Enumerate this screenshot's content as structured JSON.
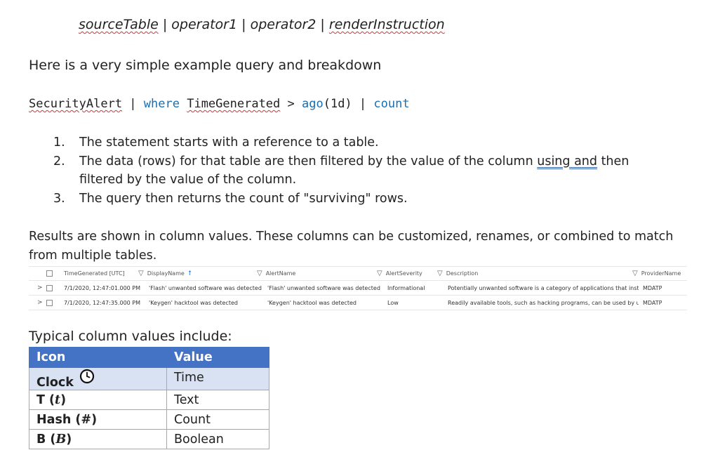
{
  "syntax": {
    "source": "sourceTable",
    "sep": " | ",
    "op1": "operator1",
    "op2": "operator2",
    "render": "renderInstruction"
  },
  "intro": "Here is a very simple example query and breakdown",
  "query": {
    "table": "SecurityAlert",
    "pipe": " | ",
    "where": "where",
    "column": "TimeGenerated",
    "gt": " > ",
    "ago": "ago",
    "ago_arg": "(1d)",
    "count": "count"
  },
  "steps": [
    {
      "num": "1.",
      "text": "The statement starts with a reference to a table."
    },
    {
      "num": "2.",
      "text_a": "The data (rows) for that table are then filtered by the value of the column ",
      "text_u": "using  and",
      "text_b": " then filtered by the value of the column."
    },
    {
      "num": "3.",
      "text": "The query then returns the count of \"surviving\" rows."
    }
  ],
  "results_text": "Results are shown in column values.  These columns can be customized, renames, or combined to match from multiple tables.",
  "grid": {
    "headers": [
      "TimeGenerated [UTC]",
      "DisplayName",
      "AlertName",
      "AlertSeverity",
      "Description",
      "ProviderName"
    ],
    "rows": [
      [
        "7/1/2020, 12:47:01.000 PM",
        "'Flash' unwanted software was detected",
        "'Flash' unwanted software was detected",
        "Informational",
        "Potentially unwanted software is a category of applications that insta...",
        "MDATP"
      ],
      [
        "7/1/2020, 12:47:35.000 PM",
        "'Keygen' hacktool was detected",
        "'Keygen' hacktool was detected",
        "Low",
        "Readily available tools, such as hacking programs, can be used by un...",
        "MDATP"
      ]
    ]
  },
  "typical_title": "Typical column values include:",
  "types_table": {
    "head_icon": "Icon",
    "head_value": "Value",
    "rows": [
      {
        "icon": "Clock",
        "symbol": "",
        "value": "Time",
        "icon_name": "clock-icon"
      },
      {
        "icon": "T (",
        "symbol": "t",
        "close": ")",
        "value": "Text"
      },
      {
        "icon": "Hash (",
        "symbol": "#",
        "close": ")",
        "value": "Count"
      },
      {
        "icon": "B (",
        "symbol": "B",
        "close": ")",
        "value": "Boolean"
      }
    ]
  }
}
